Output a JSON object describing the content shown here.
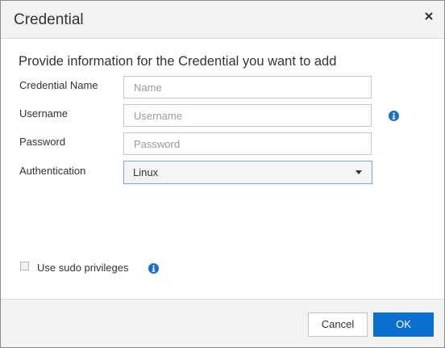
{
  "dialog": {
    "title": "Credential",
    "subtitle": "Provide information for the Credential you want to add"
  },
  "fields": {
    "credential_name": {
      "label": "Credential Name",
      "placeholder": "Name",
      "value": ""
    },
    "username": {
      "label": "Username",
      "placeholder": "Username",
      "value": ""
    },
    "password": {
      "label": "Password",
      "placeholder": "Password",
      "value": ""
    },
    "authentication": {
      "label": "Authentication",
      "selected": "Linux"
    }
  },
  "sudo": {
    "label": "Use sudo privileges",
    "checked": false
  },
  "buttons": {
    "cancel": "Cancel",
    "ok": "OK"
  },
  "icons": {
    "close": "close-icon",
    "info": "info-icon",
    "dropdown": "caret-down-icon"
  },
  "colors": {
    "primary": "#0a6fd0",
    "info_icon": "#1a6fcb",
    "header_bg": "#f2f2f2"
  }
}
